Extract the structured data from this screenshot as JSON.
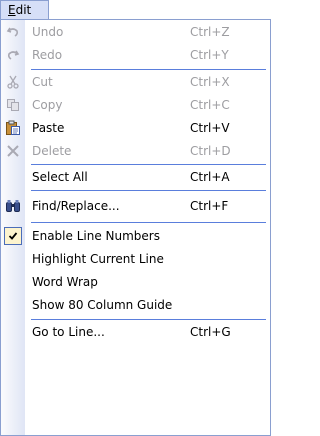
{
  "menu": {
    "title": "Edit",
    "title_mnemonic": "E",
    "title_rest": "dit"
  },
  "items": [
    {
      "label": "Undo",
      "shortcut": "Ctrl+Z",
      "enabled": false,
      "icon": "undo-icon"
    },
    {
      "label": "Redo",
      "shortcut": "Ctrl+Y",
      "enabled": false,
      "icon": "redo-icon"
    },
    {
      "label": "Cut",
      "shortcut": "Ctrl+X",
      "enabled": false,
      "icon": "scissors-icon"
    },
    {
      "label": "Copy",
      "shortcut": "Ctrl+C",
      "enabled": false,
      "icon": "copy-icon"
    },
    {
      "label": "Paste",
      "shortcut": "Ctrl+V",
      "enabled": true,
      "icon": "clipboard-paste-icon"
    },
    {
      "label": "Delete",
      "shortcut": "Ctrl+D",
      "enabled": false,
      "icon": "delete-x-icon"
    },
    {
      "label": "Select All",
      "shortcut": "Ctrl+A",
      "enabled": true,
      "icon": ""
    },
    {
      "label": "Find/Replace...",
      "shortcut": "Ctrl+F",
      "enabled": true,
      "icon": "binoculars-icon"
    },
    {
      "label": "Enable Line Numbers",
      "shortcut": "",
      "enabled": true,
      "icon": "checkmark-icon",
      "checked": true
    },
    {
      "label": "Highlight Current Line",
      "shortcut": "",
      "enabled": true,
      "icon": ""
    },
    {
      "label": "Word Wrap",
      "shortcut": "",
      "enabled": true,
      "icon": ""
    },
    {
      "label": "Show 80 Column Guide",
      "shortcut": "",
      "enabled": true,
      "icon": ""
    },
    {
      "label": "Go to Line...",
      "shortcut": "Ctrl+G",
      "enabled": true,
      "icon": ""
    }
  ],
  "colors": {
    "highlight_border": "#8a9fd0",
    "separator": "#5a7edc",
    "disabled_text": "#9d9da1",
    "check_bg": "#fdf4ce"
  }
}
